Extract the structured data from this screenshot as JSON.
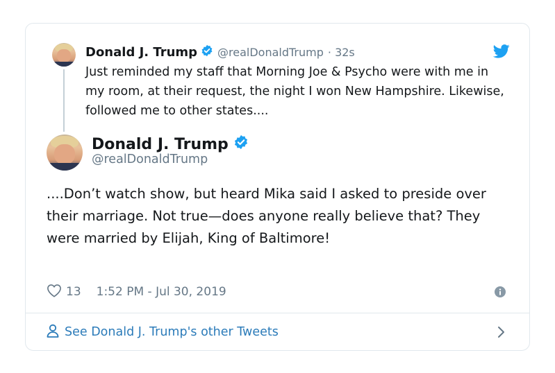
{
  "quoted_tweet": {
    "author_name": "Donald J. Trump",
    "handle": "@realDonaldTrump",
    "time": "· 32s",
    "text": "Just reminded my staff that Morning Joe & Psycho were with me in my room, at their request, the night I won New Hampshire. Likewise, followed me to other states...."
  },
  "main_tweet": {
    "author_name": "Donald J. Trump",
    "handle": "@realDonaldTrump",
    "text": "....Don’t watch show, but heard Mika said I asked to preside over their marriage. Not true—does anyone really believe that? They were married by Elijah, King of Baltimore!",
    "like_count": "13",
    "timestamp": "1:52 PM - Jul 30, 2019"
  },
  "footer": {
    "see_more_label": "See Donald J. Trump's other Tweets"
  },
  "colors": {
    "twitter_blue": "#1da1f2",
    "link_blue": "#2b7bb9",
    "secondary_text": "#657786",
    "border": "#e1e8ed"
  },
  "icons": [
    "verified-badge-icon",
    "twitter-bird-icon",
    "heart-icon",
    "info-icon",
    "user-icon",
    "chevron-right-icon"
  ]
}
